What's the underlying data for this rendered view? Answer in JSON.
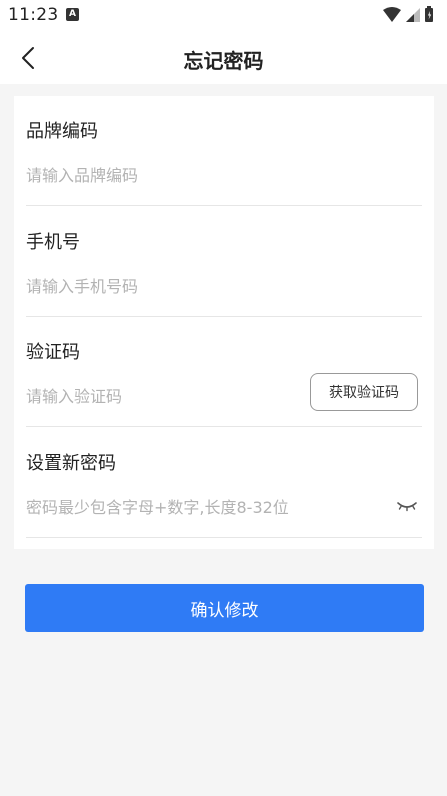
{
  "status_bar": {
    "time": "11:23",
    "notification_icon": "a-icon",
    "wifi_icon": "wifi-icon",
    "signal_icon": "signal-icon",
    "battery_icon": "battery-icon"
  },
  "nav": {
    "back_icon": "chevron-left-icon",
    "title": "忘记密码"
  },
  "form": {
    "brand_code": {
      "label": "品牌编码",
      "placeholder": "请输入品牌编码",
      "value": ""
    },
    "phone": {
      "label": "手机号",
      "placeholder": "请输入手机号码",
      "value": ""
    },
    "verify_code": {
      "label": "验证码",
      "placeholder": "请输入验证码",
      "value": "",
      "get_code_label": "获取验证码"
    },
    "new_password": {
      "label": "设置新密码",
      "placeholder": "密码最少包含字母+数字,长度8-32位",
      "value": "",
      "toggle_icon": "eye-closed-icon"
    }
  },
  "confirm_label": "确认修改",
  "colors": {
    "primary": "#2f7bf5",
    "background": "#f5f5f5",
    "card": "#ffffff"
  }
}
